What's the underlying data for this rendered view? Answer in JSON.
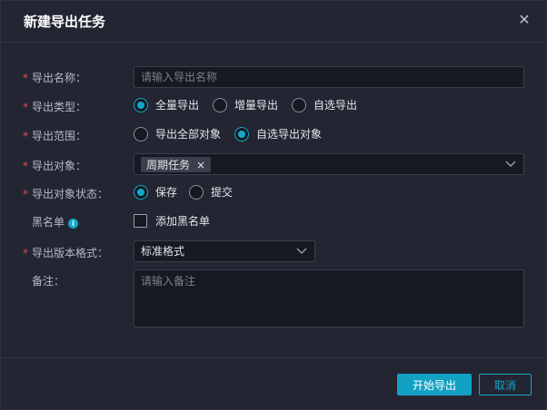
{
  "dialog": {
    "title": "新建导出任务",
    "close_icon": "close-icon"
  },
  "form": {
    "name": {
      "label": "导出名称：",
      "required_mark": "*",
      "placeholder": "请输入导出名称",
      "value": ""
    },
    "type": {
      "label": "导出类型：",
      "required_mark": "*",
      "options": [
        {
          "label": "全量导出",
          "selected": true
        },
        {
          "label": "增量导出",
          "selected": false
        },
        {
          "label": "自选导出",
          "selected": false
        }
      ]
    },
    "scope": {
      "label": "导出范围：",
      "required_mark": "*",
      "options": [
        {
          "label": "导出全部对象",
          "selected": false
        },
        {
          "label": "自选导出对象",
          "selected": true
        }
      ]
    },
    "objects": {
      "label": "导出对象：",
      "required_mark": "*",
      "tags": [
        {
          "label": "周期任务",
          "close": "×"
        }
      ],
      "icon": "chevron-down-icon"
    },
    "object_status": {
      "label": "导出对象状态：",
      "required_mark": "*",
      "options": [
        {
          "label": "保存",
          "selected": true
        },
        {
          "label": "提交",
          "selected": false
        }
      ]
    },
    "blacklist": {
      "label": "黑名单",
      "info_icon": "info-icon",
      "info_glyph": "i",
      "checkbox_label": "添加黑名单",
      "checked": false
    },
    "version_format": {
      "label": "导出版本格式：",
      "required_mark": "*",
      "value": "标准格式",
      "icon": "chevron-down-icon"
    },
    "remark": {
      "label": "备注：",
      "placeholder": "请输入备注",
      "value": ""
    }
  },
  "footer": {
    "start_label": "开始导出",
    "cancel_label": "取消"
  },
  "colors": {
    "accent": "#14a8c8",
    "required": "#e5484d",
    "background": "#232632"
  }
}
